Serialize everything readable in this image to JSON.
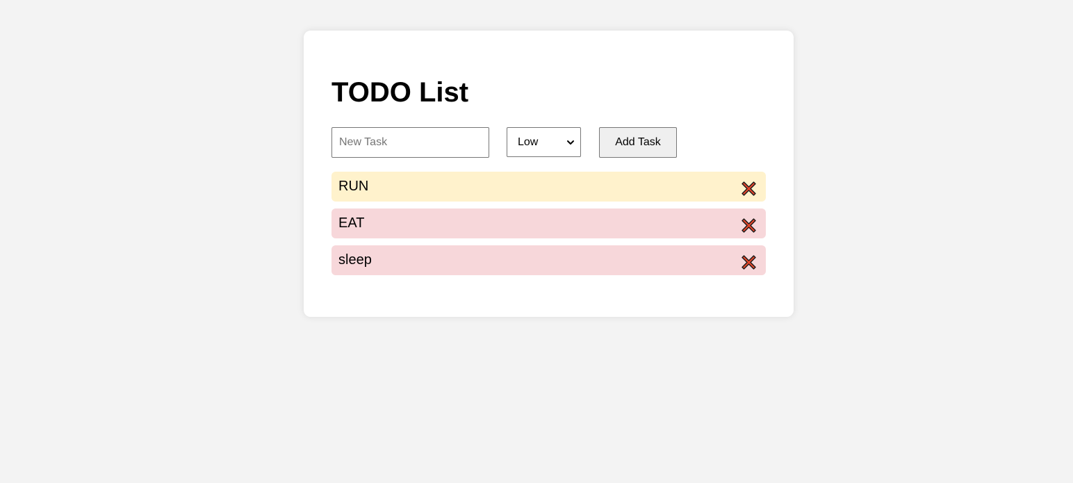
{
  "colors": {
    "page_background": "#f3f3f3",
    "card_background": "#ffffff",
    "priority_medium": "#fff2cc",
    "priority_high": "#f7d7da",
    "delete_icon": "#e2462b"
  },
  "todo": {
    "title": "TODO List",
    "new_task": {
      "placeholder": "New Task",
      "value": ""
    },
    "priority_select": {
      "selected": "Low"
    },
    "add_button_label": "Add Task",
    "tasks": [
      {
        "text": "RUN",
        "color": "#fff2cc",
        "delete_icon": "red-x-icon"
      },
      {
        "text": "EAT",
        "color": "#f7d7da",
        "delete_icon": "red-x-icon"
      },
      {
        "text": "sleep",
        "color": "#f7d7da",
        "delete_icon": "red-x-icon"
      }
    ]
  }
}
